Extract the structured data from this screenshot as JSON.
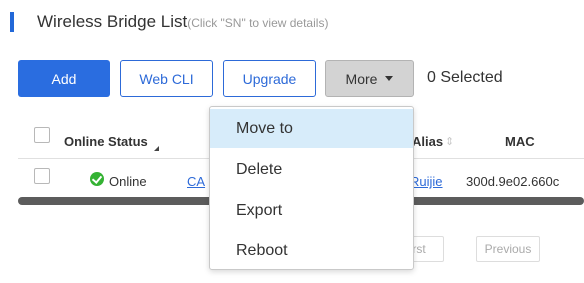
{
  "page": {
    "title": "Wireless Bridge List",
    "title_hint": "(Click \"SN\" to view details)"
  },
  "toolbar": {
    "add_label": "Add",
    "webcli_label": "Web CLI",
    "upgrade_label": "Upgrade",
    "more_label": "More",
    "selected_text": "0 Selected"
  },
  "table": {
    "headers": {
      "online_status": "Online Status",
      "alias": "Alias",
      "mac": "MAC"
    },
    "rows": [
      {
        "online_status": "Online",
        "sn_partial": "CA",
        "alias": "Ruijie",
        "mac": "300d.9e02.660c"
      }
    ]
  },
  "pagination": {
    "first_partial": "rst",
    "previous": "Previous"
  },
  "more_menu": {
    "items": [
      "Move to",
      "Delete",
      "Export",
      "Reboot"
    ],
    "highlighted_index": 0
  },
  "colors": {
    "primary": "#2a6de0",
    "online": "#34b233",
    "menu_highlight": "#d7ecfa"
  },
  "icons": [
    "caret-down-icon",
    "check-circle-icon",
    "sort-icon"
  ]
}
